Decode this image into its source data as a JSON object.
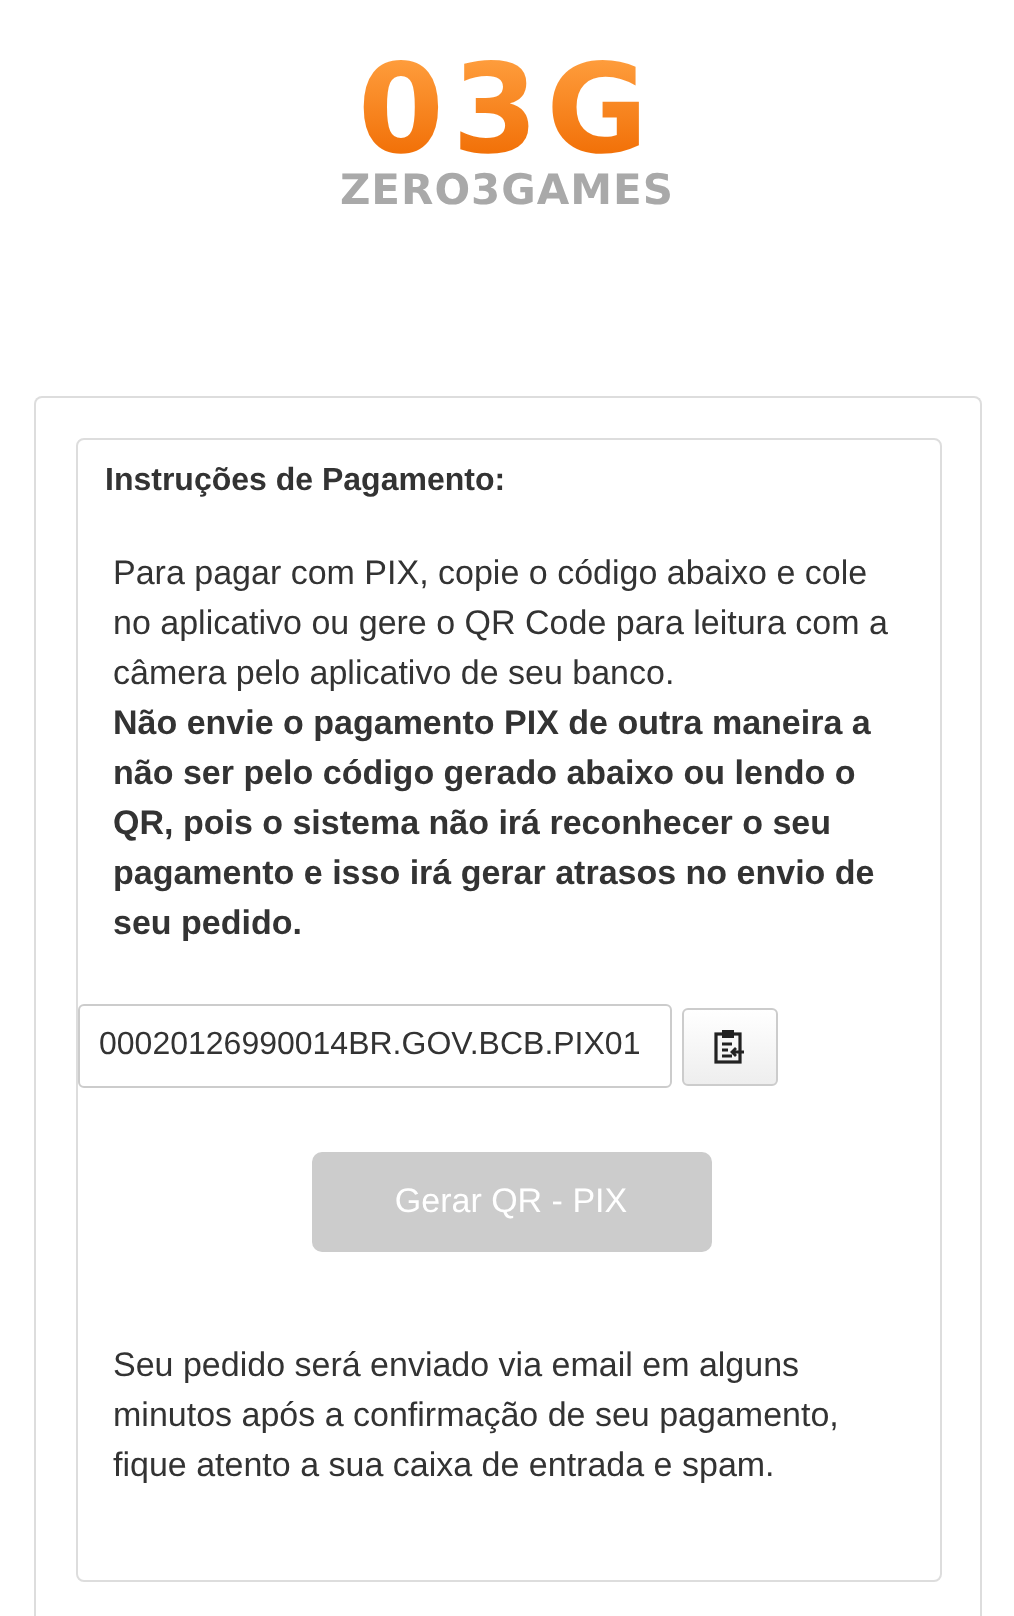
{
  "logo": {
    "mark": "03G",
    "wordmark": "ZERO3GAMES"
  },
  "panel": {
    "title": "Instruções de Pagamento:",
    "instructions": "Para pagar com PIX, copie o código abaixo e cole no aplicativo ou gere o QR Code para leitura com a câmera pelo aplicativo de seu banco.",
    "warning": "Não envie o pagamento PIX de outra maneira a não ser pelo código gerado abaixo ou lendo o QR, pois o sistema não irá reconhecer o seu pagamento e isso irá gerar atrasos no envio de seu pedido.",
    "pix_code": "00020126990014BR.GOV.BCB.PIX01",
    "qr_button": {
      "label": "Gerar QR - PIX",
      "disabled": true
    },
    "footer_note": "Seu pedido será enviado via email em alguns minutos após a confirmação de seu pagamento, fique atento a sua caixa de entrada e spam."
  }
}
